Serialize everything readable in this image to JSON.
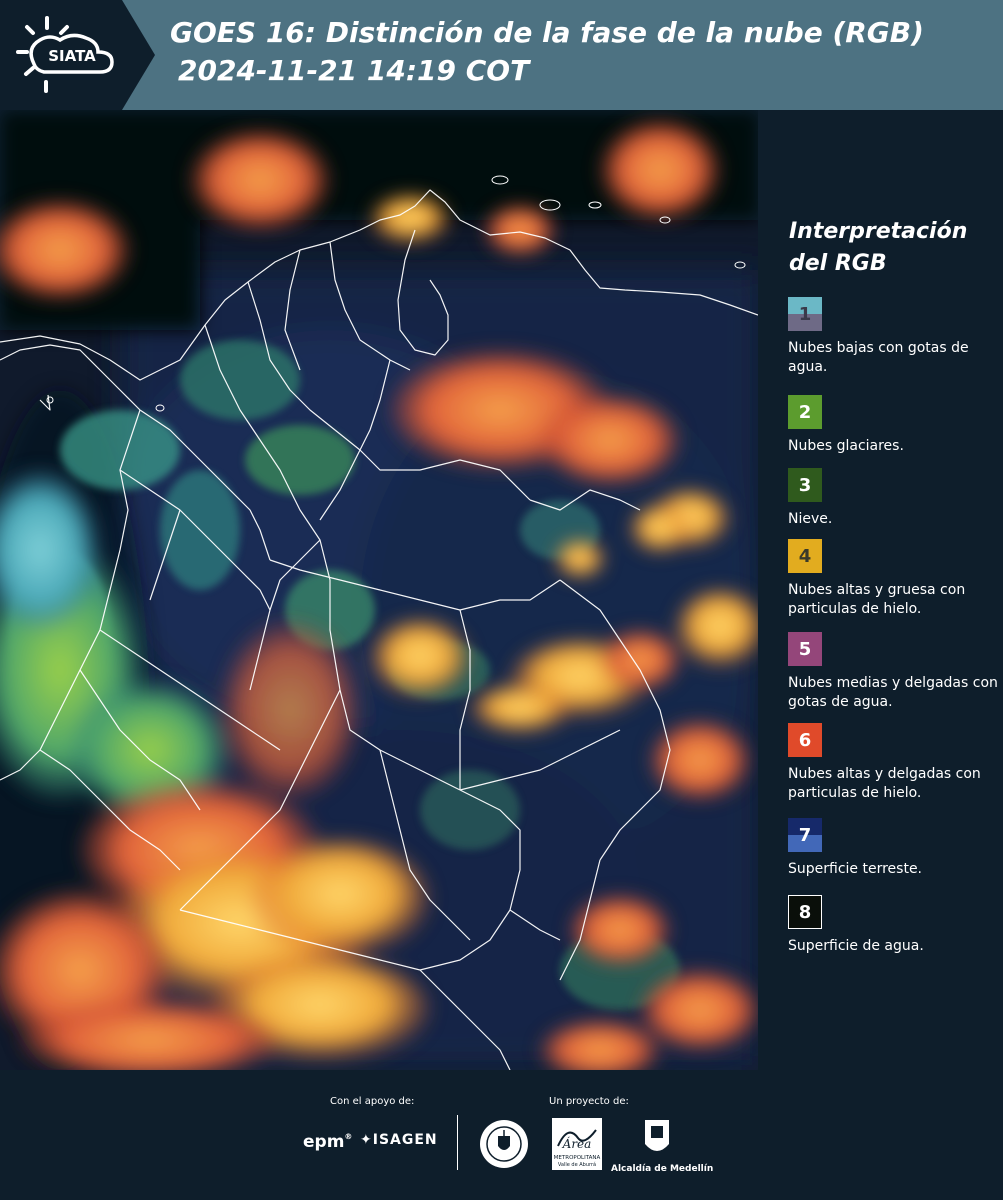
{
  "header": {
    "logo_text": "SIATA",
    "title_line1": "GOES 16: Distinción de la fase de la nube (RGB)",
    "title_line2": "2024-11-21 14:19 COT"
  },
  "legend": {
    "title": "Interpretación del RGB",
    "items": [
      {
        "number": "1",
        "label": "Nubes bajas con gotas de agua.",
        "color_top": "#6bb8c6",
        "color_bottom": "#6e6a86"
      },
      {
        "number": "2",
        "label": "Nubes glaciares.",
        "color_top": "#5c9c2e",
        "color_bottom": "#5c9c2e"
      },
      {
        "number": "3",
        "label": "Nieve.",
        "color_top": "#2f5a1d",
        "color_bottom": "#2f5a1d"
      },
      {
        "number": "4",
        "label": "Nubes altas y gruesa con particulas de hielo.",
        "color_top": "#e2ac1f",
        "color_bottom": "#e2ac1f"
      },
      {
        "number": "5",
        "label": "Nubes medias y delgadas con gotas de agua.",
        "color_top": "#94467a",
        "color_bottom": "#94467a"
      },
      {
        "number": "6",
        "label": "Nubes altas y delgadas con particulas de hielo.",
        "color_top": "#e04a2a",
        "color_bottom": "#e04a2a"
      },
      {
        "number": "7",
        "label": "Superficie terreste.",
        "color_top": "#16296a",
        "color_bottom": "#4268b8"
      },
      {
        "number": "8",
        "label": "Superficie de agua.",
        "color_top": "#0a0f0a",
        "color_bottom": "#0a0f0a"
      }
    ]
  },
  "footer": {
    "support_label": "Con el apoyo de:",
    "project_label": "Un proyecto de:",
    "epm": "epm",
    "isagen": "ISAGEN",
    "area_text": "Área",
    "area_sub": "METROPOLITANA",
    "area_sub2": "Valle de Aburrá",
    "alcaldia": "Alcaldía de Medellín"
  }
}
